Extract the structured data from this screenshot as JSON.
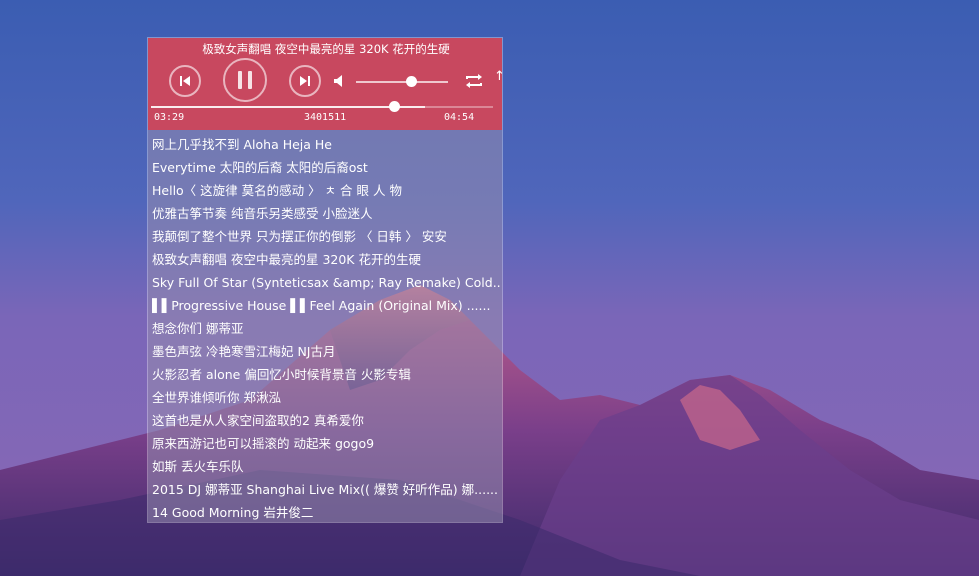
{
  "player": {
    "now_playing": "极致女声翻唱  夜空中最亮的星  320K 花开的生硬",
    "current_time": "03:29",
    "track_id": "3401511",
    "total_time": "04:54",
    "volume_level_fraction": 0.6,
    "progress_fraction": 0.71,
    "buffer_fraction": 0.8,
    "accent_color": "#c8485f"
  },
  "playlist": [
    "网上几乎找不到 Aloha Heja He",
    "Everytime 太阳的后裔  太阳的后裔ost",
    "Hello〈 这旋律 莫名的感动 〉 ㅊ 合 眼 人 物",
    "优雅古筝节奏 纯音乐另类感受 小脸迷人",
    "我颠倒了整个世界 只为摆正你的倒影 〈 日韩 〉 安安",
    "极致女声翻唱 夜空中最亮的星  320K 花开的生硬",
    "Sky Full Of Star (Synteticsax &amp; Ray Remake) Cold..",
    "▌▌Progressive House ▌▌Feel Again (Original Mix) ......",
    "想念你们 娜蒂亚",
    "墨色声弦  冷艳寒雪江梅妃 NJ古月",
    "火影忍者 alone 偏回忆小时候背景音 火影专辑",
    "全世界谁倾听你 郑湫泓",
    "这首也是从人家空间盗取的2 真希爱你",
    "原来西游记也可以摇滚的  动起来  gogo9",
    "如斯 丢火车乐队",
    "2015 DJ 娜蒂亚 Shanghai Live  Mix(( 爆赞 好听作品) 娜......",
    "14  Good  Morning 岩井俊二"
  ]
}
